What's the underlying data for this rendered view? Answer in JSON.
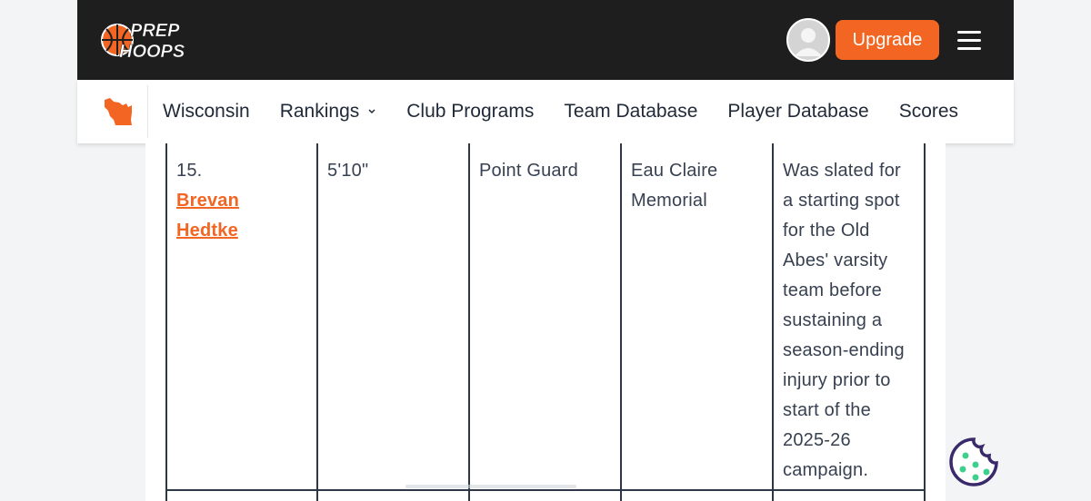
{
  "header": {
    "logo_text_line1": "PREP",
    "logo_text_line2": "HOOPS",
    "upgrade_label": "Upgrade",
    "brand_color": "#f26522"
  },
  "nav": {
    "items": [
      {
        "label": "Wisconsin"
      },
      {
        "label": "Rankings"
      },
      {
        "label": "Club Programs"
      },
      {
        "label": "Team Database"
      },
      {
        "label": "Player Database"
      },
      {
        "label": "Scores"
      }
    ]
  },
  "table": {
    "row": {
      "rank": "15.",
      "player_first": "Brevan",
      "player_last": "Hedtke",
      "height": "5'10\"",
      "position": "Point Guard",
      "school": "Eau Claire Memorial",
      "notes": "Was slated for a starting spot for the Old Abes' varsity team before sustaining a season-ending injury prior to start of the 2025-26 campaign."
    }
  },
  "icons": {
    "state": "wisconsin-map-icon",
    "menu": "hamburger-menu-icon",
    "cookie": "cookie-icon",
    "avatar": "user-avatar-icon"
  }
}
